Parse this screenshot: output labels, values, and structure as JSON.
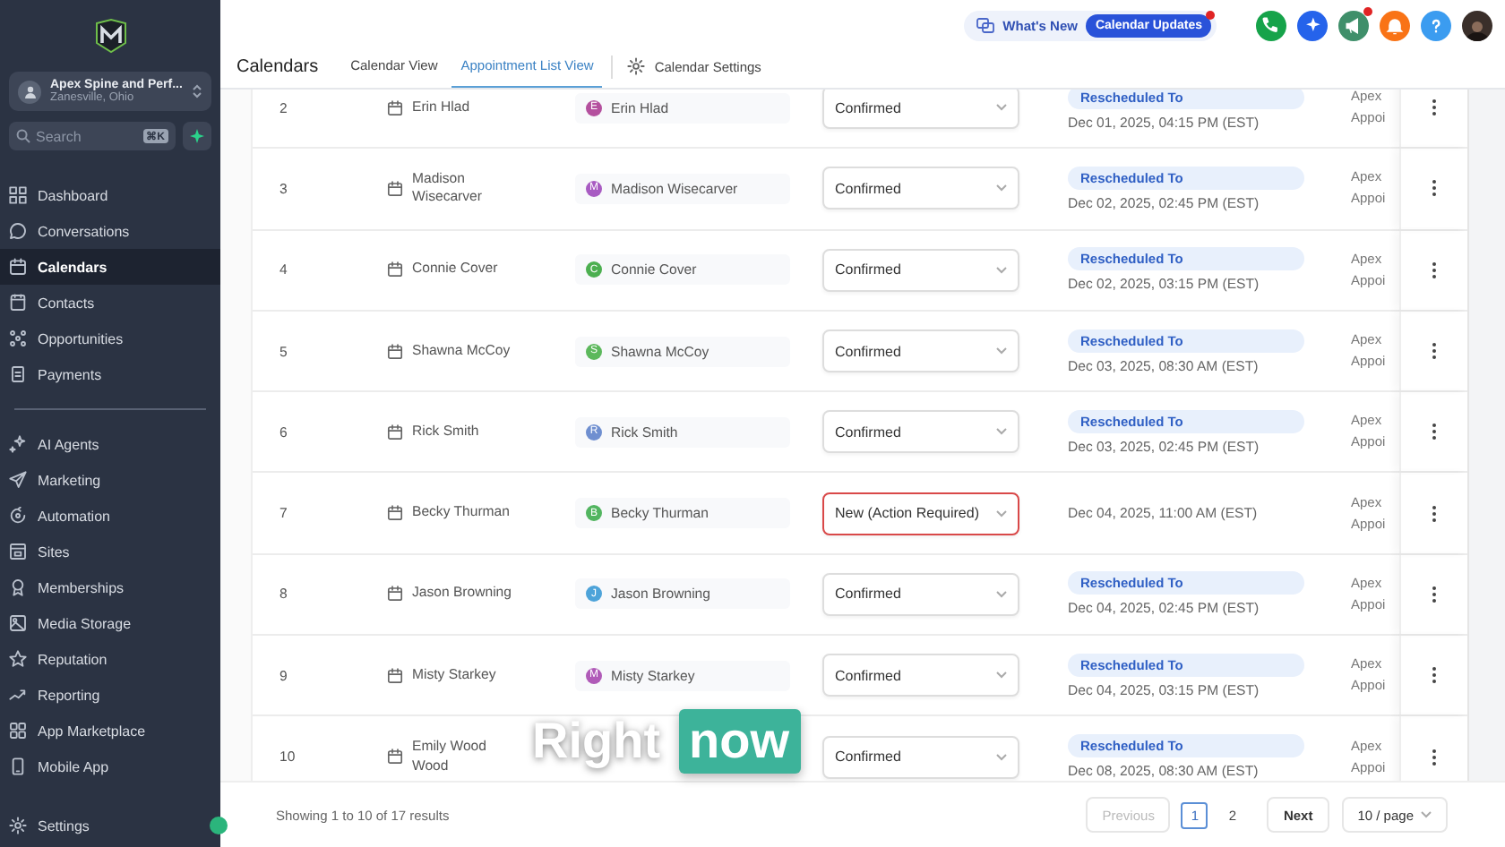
{
  "sidebar": {
    "account": {
      "name": "Apex Spine and Perf...",
      "location": "Zanesville, Ohio"
    },
    "search": {
      "placeholder": "Search",
      "shortcut": "⌘K"
    },
    "nav_main": [
      {
        "label": "Dashboard",
        "selected": false
      },
      {
        "label": "Conversations",
        "selected": false
      },
      {
        "label": "Calendars",
        "selected": true
      },
      {
        "label": "Contacts",
        "selected": false
      },
      {
        "label": "Opportunities",
        "selected": false
      },
      {
        "label": "Payments",
        "selected": false
      }
    ],
    "nav_tools": [
      {
        "label": "AI Agents",
        "selected": false
      },
      {
        "label": "Marketing",
        "selected": false
      },
      {
        "label": "Automation",
        "selected": false
      },
      {
        "label": "Sites",
        "selected": false
      },
      {
        "label": "Memberships",
        "selected": false
      },
      {
        "label": "Media Storage",
        "selected": false
      },
      {
        "label": "Reputation",
        "selected": false
      },
      {
        "label": "Reporting",
        "selected": false
      },
      {
        "label": "App Marketplace",
        "selected": false
      },
      {
        "label": "Mobile App",
        "selected": false
      }
    ],
    "settings": {
      "label": "Settings",
      "selected": false
    }
  },
  "header": {
    "whats_new": "What's New",
    "updates": {
      "label": "Calendar Updates",
      "dot": true
    },
    "actions": [
      {
        "dot": false
      },
      {
        "dot": false
      },
      {
        "dot": true
      },
      {
        "dot": false
      },
      {
        "dot": false
      }
    ],
    "title": "Calendars",
    "tabs": [
      {
        "label": "Calendar View",
        "selected": false
      },
      {
        "label": "Appointment List View",
        "selected": true
      }
    ],
    "settings_link": "Calendar Settings"
  },
  "table": {
    "rows": [
      {
        "number": "2",
        "name": "Erin Hlad",
        "contact": {
          "initial": "E",
          "name": "Erin Hlad",
          "color": "#b4509e"
        },
        "status": {
          "kind": "confirmed",
          "label": "Confirmed"
        },
        "rescheduled": "Rescheduled To",
        "date": "Dec 01, 2025, 04:15 PM (EST)",
        "calendar": [
          "Apex",
          "Appoi"
        ]
      },
      {
        "number": "3",
        "name": "Madison Wisecarver",
        "contact": {
          "initial": "M",
          "name": "Madison Wisecarver",
          "color": "#a85bc2"
        },
        "status": {
          "kind": "confirmed",
          "label": "Confirmed"
        },
        "rescheduled": "Rescheduled To",
        "date": "Dec 02, 2025, 02:45 PM (EST)",
        "calendar": [
          "Apex",
          "Appoi"
        ]
      },
      {
        "number": "4",
        "name": "Connie Cover",
        "contact": {
          "initial": "C",
          "name": "Connie Cover",
          "color": "#4caf50"
        },
        "status": {
          "kind": "confirmed",
          "label": "Confirmed"
        },
        "rescheduled": "Rescheduled To",
        "date": "Dec 02, 2025, 03:15 PM (EST)",
        "calendar": [
          "Apex",
          "Appoi"
        ]
      },
      {
        "number": "5",
        "name": "Shawna McCoy",
        "contact": {
          "initial": "S",
          "name": "Shawna McCoy",
          "color": "#5cb85c"
        },
        "status": {
          "kind": "confirmed",
          "label": "Confirmed"
        },
        "rescheduled": "Rescheduled To",
        "date": "Dec 03, 2025, 08:30 AM (EST)",
        "calendar": [
          "Apex",
          "Appoi"
        ]
      },
      {
        "number": "6",
        "name": "Rick Smith",
        "contact": {
          "initial": "R",
          "name": "Rick Smith",
          "color": "#6f8fd0"
        },
        "status": {
          "kind": "confirmed",
          "label": "Confirmed"
        },
        "rescheduled": "Rescheduled To",
        "date": "Dec 03, 2025, 02:45 PM (EST)",
        "calendar": [
          "Apex",
          "Appoi"
        ]
      },
      {
        "number": "7",
        "name": "Becky Thurman",
        "contact": {
          "initial": "B",
          "name": "Becky Thurman",
          "color": "#52b560"
        },
        "status": {
          "kind": "new",
          "label": "New (Action Required)"
        },
        "date": "Dec 04, 2025, 11:00 AM (EST)",
        "calendar": [
          "Apex",
          "Appoi"
        ]
      },
      {
        "number": "8",
        "name": "Jason Browning",
        "contact": {
          "initial": "J",
          "name": "Jason Browning",
          "color": "#4da3d9"
        },
        "status": {
          "kind": "confirmed",
          "label": "Confirmed"
        },
        "rescheduled": "Rescheduled To",
        "date": "Dec 04, 2025, 02:45 PM (EST)",
        "calendar": [
          "Apex",
          "Appoi"
        ]
      },
      {
        "number": "9",
        "name": "Misty Starkey",
        "contact": {
          "initial": "M",
          "name": "Misty Starkey",
          "color": "#b05bb8"
        },
        "status": {
          "kind": "confirmed",
          "label": "Confirmed"
        },
        "rescheduled": "Rescheduled To",
        "date": "Dec 04, 2025, 03:15 PM (EST)",
        "calendar": [
          "Apex",
          "Appoi"
        ]
      },
      {
        "number": "10",
        "name": "Emily Wood Wood",
        "status": {
          "kind": "confirmed",
          "label": "Confirmed"
        },
        "rescheduled": "Rescheduled To",
        "date": "Dec 08, 2025, 08:30 AM (EST)",
        "calendar": [
          "Apex",
          "Appoi"
        ]
      }
    ]
  },
  "footer": {
    "summary": "Showing 1 to 10 of 17 results",
    "previous": {
      "label": "Previous",
      "disabled": true
    },
    "pages": [
      {
        "label": "1",
        "selected": true
      },
      {
        "label": "2",
        "selected": false
      }
    ],
    "next": {
      "label": "Next",
      "disabled": false
    },
    "page_size": "10 / page"
  },
  "caption": [
    {
      "text": "Right",
      "boxed": false
    },
    {
      "text": "now",
      "boxed": true
    }
  ]
}
